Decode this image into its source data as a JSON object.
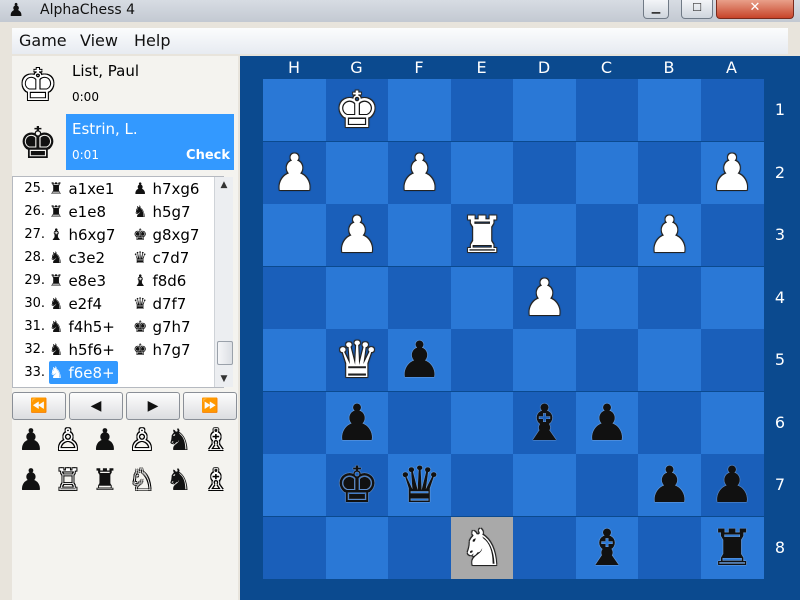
{
  "window": {
    "title": "AlphaChess 4",
    "icon": "pawn-icon"
  },
  "menu": [
    "Game",
    "View",
    "Help"
  ],
  "players": [
    {
      "name": "List, Paul",
      "time": "0:00",
      "color": "white",
      "status": ""
    },
    {
      "name": "Estrin, L.",
      "time": "0:01",
      "color": "black",
      "status": "Check"
    }
  ],
  "moves": [
    {
      "num": "25.",
      "white": {
        "piece": "♜",
        "text": "a1xe1"
      },
      "black": {
        "piece": "♟",
        "text": "h7xg6"
      }
    },
    {
      "num": "26.",
      "white": {
        "piece": "♜",
        "text": "e1e8"
      },
      "black": {
        "piece": "♞",
        "text": "h5g7"
      }
    },
    {
      "num": "27.",
      "white": {
        "piece": "♝",
        "text": "h6xg7"
      },
      "black": {
        "piece": "♚",
        "text": "g8xg7"
      }
    },
    {
      "num": "28.",
      "white": {
        "piece": "♞",
        "text": "c3e2"
      },
      "black": {
        "piece": "♛",
        "text": "c7d7"
      }
    },
    {
      "num": "29.",
      "white": {
        "piece": "♜",
        "text": "e8e3"
      },
      "black": {
        "piece": "♝",
        "text": "f8d6"
      }
    },
    {
      "num": "30.",
      "white": {
        "piece": "♞",
        "text": "e2f4"
      },
      "black": {
        "piece": "♛",
        "text": "d7f7"
      }
    },
    {
      "num": "31.",
      "white": {
        "piece": "♞",
        "text": "f4h5+"
      },
      "black": {
        "piece": "♚",
        "text": "g7h7"
      }
    },
    {
      "num": "32.",
      "white": {
        "piece": "♞",
        "text": "h5f6+"
      },
      "black": {
        "piece": "♚",
        "text": "h7g7"
      }
    },
    {
      "num": "33.",
      "white": {
        "piece": "♞",
        "text": "f6e8+"
      },
      "black": null
    }
  ],
  "selected_move": "33. f6e8+",
  "nav": [
    "⏪",
    "◀",
    "▶",
    "⏩"
  ],
  "captured": [
    {
      "glyph": "♟",
      "color": "black"
    },
    {
      "glyph": "♙",
      "color": "white"
    },
    {
      "glyph": "♟",
      "color": "black"
    },
    {
      "glyph": "♙",
      "color": "white"
    },
    {
      "glyph": "♞",
      "color": "black"
    },
    {
      "glyph": "♗",
      "color": "white"
    },
    {
      "glyph": "♟",
      "color": "black"
    },
    {
      "glyph": "♖",
      "color": "white"
    },
    {
      "glyph": "♜",
      "color": "black"
    },
    {
      "glyph": "♘",
      "color": "white"
    },
    {
      "glyph": "♞",
      "color": "black"
    },
    {
      "glyph": "♗",
      "color": "white"
    }
  ],
  "board": {
    "files": [
      "H",
      "G",
      "F",
      "E",
      "D",
      "C",
      "B",
      "A"
    ],
    "ranks": [
      "1",
      "2",
      "3",
      "4",
      "5",
      "6",
      "7",
      "8"
    ],
    "highlight": "e8",
    "pieces": [
      {
        "square": "g1",
        "type": "king",
        "color": "white"
      },
      {
        "square": "h2",
        "type": "pawn",
        "color": "white"
      },
      {
        "square": "f2",
        "type": "pawn",
        "color": "white"
      },
      {
        "square": "a2",
        "type": "pawn",
        "color": "white"
      },
      {
        "square": "g3",
        "type": "pawn",
        "color": "white"
      },
      {
        "square": "e3",
        "type": "rook",
        "color": "white"
      },
      {
        "square": "b3",
        "type": "pawn",
        "color": "white"
      },
      {
        "square": "d4",
        "type": "pawn",
        "color": "white"
      },
      {
        "square": "g5",
        "type": "queen",
        "color": "white"
      },
      {
        "square": "f5",
        "type": "pawn",
        "color": "black"
      },
      {
        "square": "g6",
        "type": "pawn",
        "color": "black"
      },
      {
        "square": "d6",
        "type": "bishop",
        "color": "black"
      },
      {
        "square": "c6",
        "type": "pawn",
        "color": "black"
      },
      {
        "square": "g7",
        "type": "king",
        "color": "black"
      },
      {
        "square": "f7",
        "type": "queen",
        "color": "black"
      },
      {
        "square": "b7",
        "type": "pawn",
        "color": "black"
      },
      {
        "square": "a7",
        "type": "pawn",
        "color": "black"
      },
      {
        "square": "e8",
        "type": "knight",
        "color": "white"
      },
      {
        "square": "c8",
        "type": "bishop",
        "color": "black"
      },
      {
        "square": "a8",
        "type": "rook",
        "color": "black"
      }
    ]
  },
  "colors": {
    "board_light": "#2a78d6",
    "board_dark": "#1a5fba",
    "highlight": "#a9a9a9",
    "selection": "#3399ff"
  }
}
